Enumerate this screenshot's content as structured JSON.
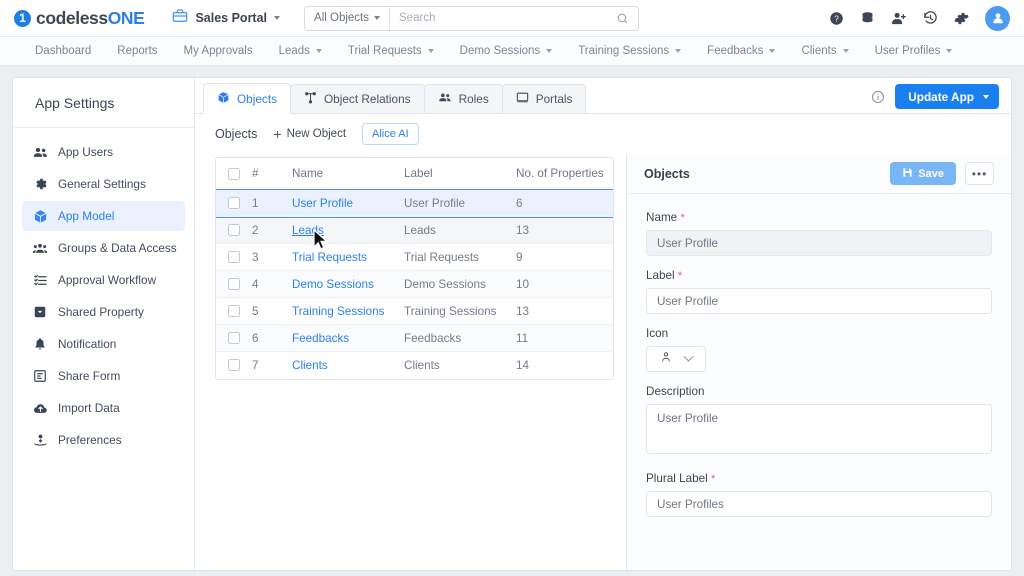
{
  "topbar": {
    "logo": {
      "mark": "1",
      "text_dark": "codeless",
      "text_blue": "ONE",
      "name": "codelessONE"
    },
    "portal_icon": "briefcase-icon",
    "portal_name": "Sales Portal",
    "search": {
      "scope": "All Objects",
      "placeholder": "Search",
      "value": ""
    },
    "actions": [
      {
        "name": "help-icon",
        "label": "Help"
      },
      {
        "name": "database-icon",
        "label": "Data"
      },
      {
        "name": "add-user-icon",
        "label": "Add User"
      },
      {
        "name": "history-icon",
        "label": "History"
      },
      {
        "name": "gear-icon",
        "label": "Settings"
      },
      {
        "name": "avatar",
        "label": "Account"
      }
    ]
  },
  "nav": [
    {
      "label": "Dashboard",
      "caret": false
    },
    {
      "label": "Reports",
      "caret": false
    },
    {
      "label": "My Approvals",
      "caret": false
    },
    {
      "label": "Leads",
      "caret": true
    },
    {
      "label": "Trial Requests",
      "caret": true
    },
    {
      "label": "Demo Sessions",
      "caret": true
    },
    {
      "label": "Training Sessions",
      "caret": true
    },
    {
      "label": "Feedbacks",
      "caret": true
    },
    {
      "label": "Clients",
      "caret": true
    },
    {
      "label": "User Profiles",
      "caret": true
    }
  ],
  "sidebar": {
    "title": "App Settings",
    "items": [
      {
        "label": "App Users",
        "icon": "users-icon",
        "active": false
      },
      {
        "label": "General Settings",
        "icon": "gear-icon",
        "active": false
      },
      {
        "label": "App Model",
        "icon": "cube-icon",
        "active": true
      },
      {
        "label": "Groups & Data Access",
        "icon": "group-icon",
        "active": false
      },
      {
        "label": "Approval Workflow",
        "icon": "checklist-icon",
        "active": false
      },
      {
        "label": "Shared Property",
        "icon": "tag-icon",
        "active": false
      },
      {
        "label": "Notification",
        "icon": "bell-icon",
        "active": false
      },
      {
        "label": "Share Form",
        "icon": "form-icon",
        "active": false
      },
      {
        "label": "Import Data",
        "icon": "cloud-upload-icon",
        "active": false
      },
      {
        "label": "Preferences",
        "icon": "preferences-icon",
        "active": false
      }
    ]
  },
  "main": {
    "tabs": [
      {
        "label": "Objects",
        "icon": "cube-icon",
        "active": true
      },
      {
        "label": "Object Relations",
        "icon": "relations-icon",
        "active": false
      },
      {
        "label": "Roles",
        "icon": "users-icon",
        "active": false
      },
      {
        "label": "Portals",
        "icon": "monitor-icon",
        "active": false
      }
    ],
    "info_icon": "info-icon",
    "update_app_label": "Update App",
    "subbar": {
      "title": "Objects",
      "new_object_label": "New Object",
      "alice_label": "Alice AI"
    },
    "table": {
      "columns": [
        "#",
        "Name",
        "Label",
        "No. of Properties"
      ],
      "rows": [
        {
          "num": "1",
          "name": "User Profile",
          "label": "User Profile",
          "props": "6",
          "selected": true,
          "hovered": false
        },
        {
          "num": "2",
          "name": "Leads",
          "label": "Leads",
          "props": "13",
          "selected": false,
          "hovered": true
        },
        {
          "num": "3",
          "name": "Trial Requests",
          "label": "Trial Requests",
          "props": "9",
          "selected": false,
          "hovered": false
        },
        {
          "num": "4",
          "name": "Demo Sessions",
          "label": "Demo Sessions",
          "props": "10",
          "selected": false,
          "hovered": false
        },
        {
          "num": "5",
          "name": "Training Sessions",
          "label": "Training Sessions",
          "props": "13",
          "selected": false,
          "hovered": false
        },
        {
          "num": "6",
          "name": "Feedbacks",
          "label": "Feedbacks",
          "props": "11",
          "selected": false,
          "hovered": false
        },
        {
          "num": "7",
          "name": "Clients",
          "label": "Clients",
          "props": "14",
          "selected": false,
          "hovered": false
        }
      ]
    }
  },
  "panel": {
    "title": "Objects",
    "save_label": "Save",
    "more_label": "•••",
    "fields": {
      "name": {
        "label": "Name",
        "required": true,
        "value": "User Profile",
        "readonly": true
      },
      "label": {
        "label": "Label",
        "required": true,
        "value": "User Profile",
        "readonly": false
      },
      "icon": {
        "label": "Icon",
        "required": false,
        "value": "person-icon"
      },
      "description": {
        "label": "Description",
        "required": false,
        "value": "User Profile"
      },
      "plural_label": {
        "label": "Plural Label",
        "required": true,
        "value": "User Profiles"
      }
    }
  },
  "colors": {
    "accent": "#2d7ff0",
    "primary_button": "#1b80ef",
    "save_button": "#79b6f5",
    "required": "#f0556a",
    "selected_row": "#e9f2fe"
  }
}
